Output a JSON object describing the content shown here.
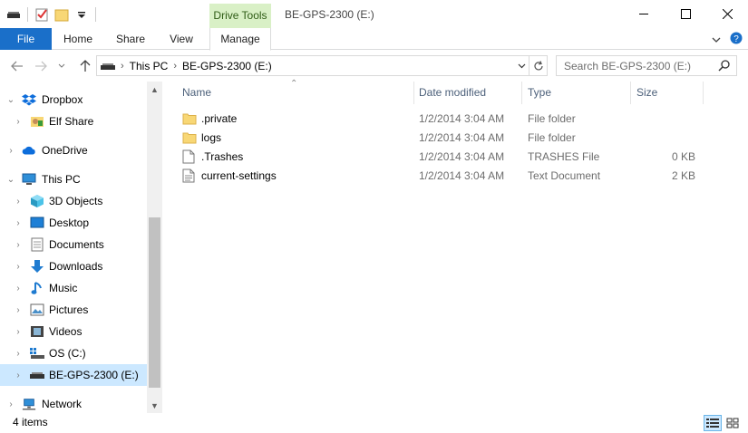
{
  "window": {
    "title": "BE-GPS-2300 (E:)",
    "context_tab_header": "Drive Tools"
  },
  "ribbon": {
    "tabs": [
      {
        "label": "File"
      },
      {
        "label": "Home"
      },
      {
        "label": "Share"
      },
      {
        "label": "View"
      },
      {
        "label": "Manage"
      }
    ]
  },
  "address": {
    "segments": [
      "This PC",
      "BE-GPS-2300 (E:)"
    ]
  },
  "search": {
    "placeholder": "Search BE-GPS-2300 (E:)"
  },
  "nav": {
    "items": [
      {
        "label": "Dropbox",
        "icon": "dropbox-icon"
      },
      {
        "label": "Elf Share",
        "icon": "shared-folder-icon"
      },
      {
        "label": "OneDrive",
        "icon": "onedrive-icon"
      },
      {
        "label": "This PC",
        "icon": "computer-icon"
      },
      {
        "label": "3D Objects",
        "icon": "cube-icon"
      },
      {
        "label": "Desktop",
        "icon": "desktop-icon"
      },
      {
        "label": "Documents",
        "icon": "documents-icon"
      },
      {
        "label": "Downloads",
        "icon": "download-icon"
      },
      {
        "label": "Music",
        "icon": "music-icon"
      },
      {
        "label": "Pictures",
        "icon": "pictures-icon"
      },
      {
        "label": "Videos",
        "icon": "videos-icon"
      },
      {
        "label": "OS (C:)",
        "icon": "os-drive-icon"
      },
      {
        "label": "BE-GPS-2300 (E:)",
        "icon": "usb-drive-icon"
      },
      {
        "label": "Network",
        "icon": "network-icon"
      }
    ]
  },
  "columns": {
    "name": "Name",
    "date": "Date modified",
    "type": "Type",
    "size": "Size"
  },
  "files": [
    {
      "name": ".private",
      "date": "1/2/2014 3:04 AM",
      "type": "File folder",
      "size": "",
      "icon": "folder-icon"
    },
    {
      "name": "logs",
      "date": "1/2/2014 3:04 AM",
      "type": "File folder",
      "size": "",
      "icon": "folder-icon"
    },
    {
      "name": ".Trashes",
      "date": "1/2/2014 3:04 AM",
      "type": "TRASHES File",
      "size": "0 KB",
      "icon": "file-icon"
    },
    {
      "name": "current-settings",
      "date": "1/2/2014 3:04 AM",
      "type": "Text Document",
      "size": "2 KB",
      "icon": "text-document-icon"
    }
  ],
  "status": {
    "count": "4 items"
  },
  "colors": {
    "accent": "#1a6fc9",
    "context_tab": "#d9f0c6",
    "selection": "#cce8ff",
    "folder": "#f8d775"
  }
}
